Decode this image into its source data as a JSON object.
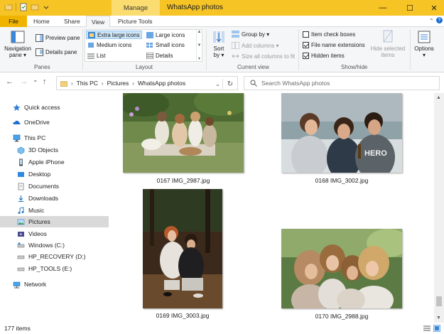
{
  "window": {
    "title": "WhatsApp photos",
    "context_tab": "Manage",
    "controls": {
      "minimize": "—",
      "maximize": "☐",
      "close": "✕"
    }
  },
  "ribbon_tabs": {
    "file": "File",
    "home": "Home",
    "share": "Share",
    "view": "View",
    "picture_tools": "Picture Tools"
  },
  "ribbon": {
    "panes": {
      "navigation_pane": "Navigation",
      "navigation_pane_2": "pane ▾",
      "preview_pane": "Preview pane",
      "details_pane": "Details pane",
      "label": "Panes"
    },
    "layout": {
      "extra_large_icons": "Extra large icons",
      "large_icons": "Large icons",
      "medium_icons": "Medium icons",
      "small_icons": "Small icons",
      "list": "List",
      "details": "Details",
      "label": "Layout",
      "selected": "Extra large icons"
    },
    "current_view": {
      "sort_by": "Sort",
      "sort_by_2": "by ▾",
      "group_by": "Group by ▾",
      "add_columns": "Add columns ▾",
      "size_all_columns": "Size all columns to fit",
      "label": "Current view"
    },
    "show_hide": {
      "item_check_boxes": "Item check boxes",
      "file_name_extensions": "File name extensions",
      "hidden_items": "Hidden items",
      "hide_selected": "Hide selected",
      "hide_selected_2": "items",
      "label": "Show/hide",
      "checks": {
        "item_check_boxes": false,
        "file_name_extensions": true,
        "hidden_items": true
      }
    },
    "options": {
      "label": "Options",
      "label_2": "▾"
    }
  },
  "navigation": {
    "back": "←",
    "forward": "→",
    "recent": "⌄",
    "up": "↑",
    "breadcrumb": [
      "This PC",
      "Pictures",
      "WhatsApp photos"
    ],
    "dropdown": "⌄",
    "refresh": "↻",
    "search_placeholder": "Search WhatsApp photos"
  },
  "sidebar": {
    "quick_access": "Quick access",
    "onedrive": "OneDrive",
    "this_pc": "This PC",
    "items": [
      {
        "label": "3D Objects",
        "icon": "3d-objects-icon"
      },
      {
        "label": "Apple iPhone",
        "icon": "phone-icon"
      },
      {
        "label": "Desktop",
        "icon": "desktop-icon"
      },
      {
        "label": "Documents",
        "icon": "documents-icon"
      },
      {
        "label": "Downloads",
        "icon": "downloads-icon"
      },
      {
        "label": "Music",
        "icon": "music-icon"
      },
      {
        "label": "Pictures",
        "icon": "pictures-icon"
      },
      {
        "label": "Videos",
        "icon": "videos-icon"
      },
      {
        "label": "Windows (C:)",
        "icon": "drive-icon"
      },
      {
        "label": "HP_RECOVERY (D:)",
        "icon": "drive-icon"
      },
      {
        "label": "HP_TOOLS (E:)",
        "icon": "drive-icon"
      }
    ],
    "network": "Network",
    "selected": "Pictures"
  },
  "files": [
    {
      "name": "0167 IMG_2987.jpg"
    },
    {
      "name": "0168 IMG_3002.jpg"
    },
    {
      "name": "0169 IMG_3003.jpg"
    },
    {
      "name": "0170 IMG_2988.jpg"
    }
  ],
  "status": {
    "item_count": "177 items"
  },
  "colors": {
    "titlebar": "#f7c425",
    "file_tab": "#f0b400",
    "selection": "#cce4f7",
    "sidebar_selected": "#d9d9d9"
  }
}
